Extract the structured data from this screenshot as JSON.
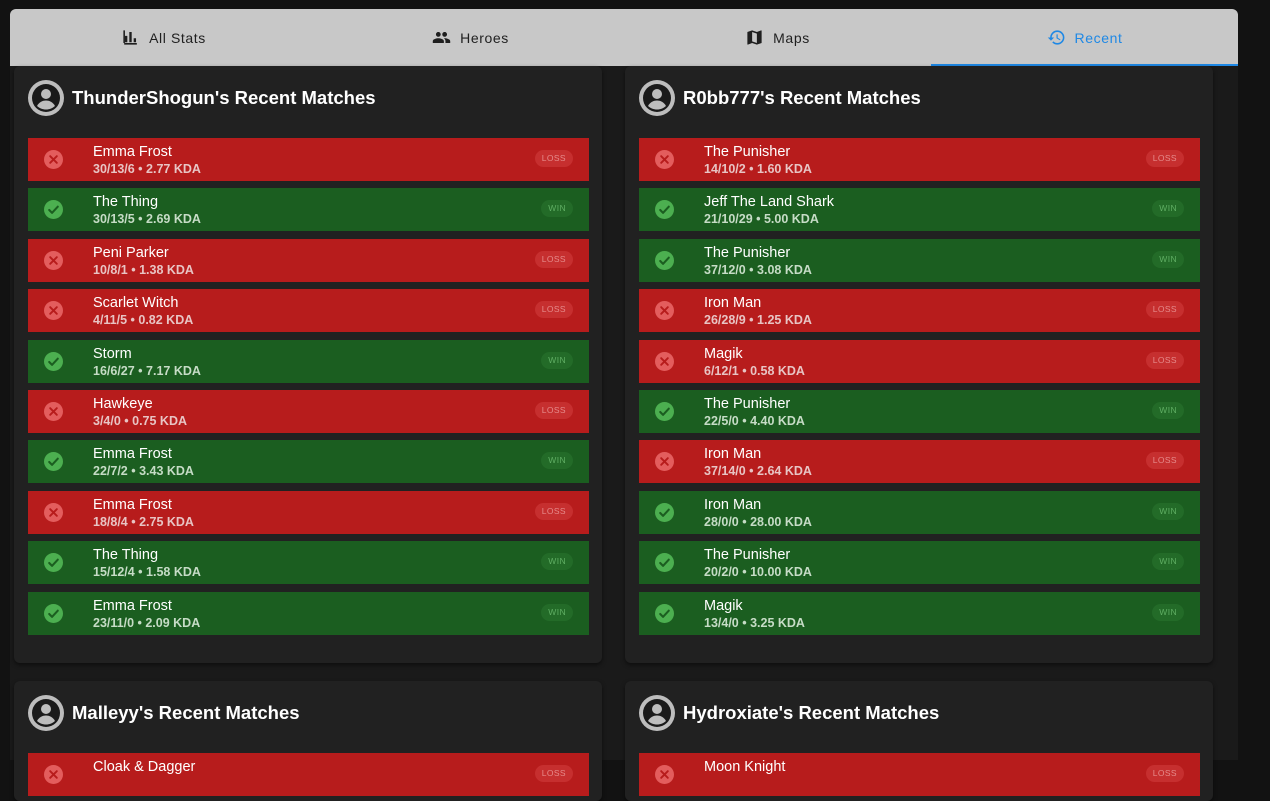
{
  "tabs": [
    {
      "label": "All Stats",
      "icon": "bar-chart-icon"
    },
    {
      "label": "Heroes",
      "icon": "people-icon"
    },
    {
      "label": "Maps",
      "icon": "map-icon"
    },
    {
      "label": "Recent",
      "icon": "history-icon"
    }
  ],
  "colors": {
    "accent": "#1e88e5",
    "loss": "#b71c1c",
    "win": "#1b5e20"
  },
  "players": [
    {
      "title": "ThunderShogun's Recent Matches",
      "matches": [
        {
          "hero": "Emma Frost",
          "stats": "30/13/6 • 2.77 KDA",
          "result": "LOSS"
        },
        {
          "hero": "The Thing",
          "stats": "30/13/5 • 2.69 KDA",
          "result": "WIN"
        },
        {
          "hero": "Peni Parker",
          "stats": "10/8/1 • 1.38 KDA",
          "result": "LOSS"
        },
        {
          "hero": "Scarlet Witch",
          "stats": "4/11/5 • 0.82 KDA",
          "result": "LOSS"
        },
        {
          "hero": "Storm",
          "stats": "16/6/27 • 7.17 KDA",
          "result": "WIN"
        },
        {
          "hero": "Hawkeye",
          "stats": "3/4/0 • 0.75 KDA",
          "result": "LOSS"
        },
        {
          "hero": "Emma Frost",
          "stats": "22/7/2 • 3.43 KDA",
          "result": "WIN"
        },
        {
          "hero": "Emma Frost",
          "stats": "18/8/4 • 2.75 KDA",
          "result": "LOSS"
        },
        {
          "hero": "The Thing",
          "stats": "15/12/4 • 1.58 KDA",
          "result": "WIN"
        },
        {
          "hero": "Emma Frost",
          "stats": "23/11/0 • 2.09 KDA",
          "result": "WIN"
        }
      ]
    },
    {
      "title": "R0bb777's Recent Matches",
      "matches": [
        {
          "hero": "The Punisher",
          "stats": "14/10/2 • 1.60 KDA",
          "result": "LOSS"
        },
        {
          "hero": "Jeff The Land Shark",
          "stats": "21/10/29 • 5.00 KDA",
          "result": "WIN"
        },
        {
          "hero": "The Punisher",
          "stats": "37/12/0 • 3.08 KDA",
          "result": "WIN"
        },
        {
          "hero": "Iron Man",
          "stats": "26/28/9 • 1.25 KDA",
          "result": "LOSS"
        },
        {
          "hero": "Magik",
          "stats": "6/12/1 • 0.58 KDA",
          "result": "LOSS"
        },
        {
          "hero": "The Punisher",
          "stats": "22/5/0 • 4.40 KDA",
          "result": "WIN"
        },
        {
          "hero": "Iron Man",
          "stats": "37/14/0 • 2.64 KDA",
          "result": "LOSS"
        },
        {
          "hero": "Iron Man",
          "stats": "28/0/0 • 28.00 KDA",
          "result": "WIN"
        },
        {
          "hero": "The Punisher",
          "stats": "20/2/0 • 10.00 KDA",
          "result": "WIN"
        },
        {
          "hero": "Magik",
          "stats": "13/4/0 • 3.25 KDA",
          "result": "WIN"
        }
      ]
    },
    {
      "title": "Malleyy's Recent Matches",
      "matches": [
        {
          "hero": "Cloak & Dagger",
          "stats": "",
          "result": "LOSS"
        }
      ]
    },
    {
      "title": "Hydroxiate's Recent Matches",
      "matches": [
        {
          "hero": "Moon Knight",
          "stats": "",
          "result": "LOSS"
        }
      ]
    }
  ]
}
